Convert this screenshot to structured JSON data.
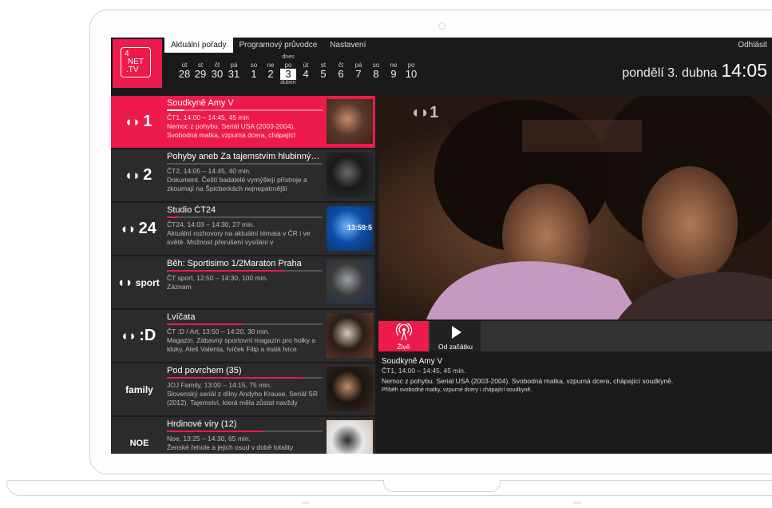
{
  "header": {
    "logo_line1": "4",
    "logo_line2": "NET",
    "logo_line3": ".TV",
    "tabs": [
      {
        "label": "Aktuální pořady",
        "active": true
      },
      {
        "label": "Programový průvodce",
        "active": false
      },
      {
        "label": "Nastavení",
        "active": false
      }
    ],
    "logout": "Odhlásit",
    "today_label": "dnes",
    "month_label": "duben",
    "days": [
      {
        "wd": "út",
        "num": "28"
      },
      {
        "wd": "st",
        "num": "29"
      },
      {
        "wd": "čt",
        "num": "30"
      },
      {
        "wd": "pá",
        "num": "31"
      },
      {
        "wd": "so",
        "num": "1"
      },
      {
        "wd": "ne",
        "num": "2"
      },
      {
        "wd": "po",
        "num": "3"
      },
      {
        "wd": "út",
        "num": "4"
      },
      {
        "wd": "st",
        "num": "5"
      },
      {
        "wd": "čt",
        "num": "6"
      },
      {
        "wd": "pá",
        "num": "7"
      },
      {
        "wd": "so",
        "num": "8"
      },
      {
        "wd": "ne",
        "num": "9"
      },
      {
        "wd": "po",
        "num": "10"
      }
    ],
    "date_text": "pondělí 3. dubna",
    "time_text": "14:05"
  },
  "channels": [
    {
      "logo": "1",
      "title": "Soudkyně Amy V",
      "meta": "ČT1, 14:00 – 14:45, 45 min",
      "desc": "Nemoc z pohybu. Seriál USA (2003-2004). Svobodná matka, vzpurná dcera, chápající",
      "progress": 0.11,
      "active": true
    },
    {
      "logo": "2",
      "title": "Pohyby aneb Za tajemstvím hlubinných...",
      "meta": "ČT2, 14:05 – 14:45, 40 min.",
      "desc": "Dokument. Čeští badatelé vymýšlejí přístroje a zkoumají na Špicberkách nejnepatrnější",
      "progress": 0.0,
      "active": false
    },
    {
      "logo": "24",
      "title": "Studio ČT24",
      "meta": "ČT24, 14:03 – 14:30, 27 min.",
      "desc": "Aktuální rozhovory na aktuální témata v ČR i ve světě. Možnost přerušení vysílání v",
      "progress": 0.07,
      "active": false
    },
    {
      "logo": "sport",
      "title": "Běh: Sportisimo 1/2Maraton Praha",
      "meta": "ČT sport, 12:50 – 14:30, 100 min.",
      "desc": "Záznam",
      "progress": 0.75,
      "active": false
    },
    {
      "logo": ":D",
      "title": "Lvíčata",
      "meta": "ČT :D / Art, 13:50 – 14:20, 30 min.",
      "desc": "Magazín. Zábavný sportovní magazín pro holky a kluky. Aleš Valenta, Ivíček Filip a malá Ivice",
      "progress": 0.5,
      "active": false
    },
    {
      "logo": "family",
      "title": "Pod povrchem (35)",
      "meta": "JOJ Family, 13:00 – 14:15, 75 min.",
      "desc": "Slovenský seriál z dílny Andyho Krause. Seriál SR (2012). Tajemství, která měla zůstat navždy",
      "progress": 0.87,
      "active": false
    },
    {
      "logo": "NOE",
      "title": "Hrdinové víry (12)",
      "meta": "Noe, 13:25 – 14:30, 65 min.",
      "desc": "Ženské řehole a jejich osud v době totality",
      "progress": 0.62,
      "active": false
    }
  ],
  "player": {
    "channel_watermark": "1",
    "live_label": "Živě",
    "start_label": "Od začátku",
    "thumb_clock": "13:59:5"
  },
  "info": {
    "title": "Soudkyně Amy V",
    "meta": "ČT1, 14:00 – 14:45, 45 min.",
    "desc": "Nemoc z pohybu. Seriál USA (2003-2004). Svobodná matka, vzpurná dcera, chápající soudkyně.",
    "sub": "Příběh svobodné matky, vzpurné dcery i chápající soudkyně."
  },
  "colors": {
    "accent": "#ec1b4b",
    "background": "#1a1a1a",
    "row": "#2b2b2b"
  }
}
